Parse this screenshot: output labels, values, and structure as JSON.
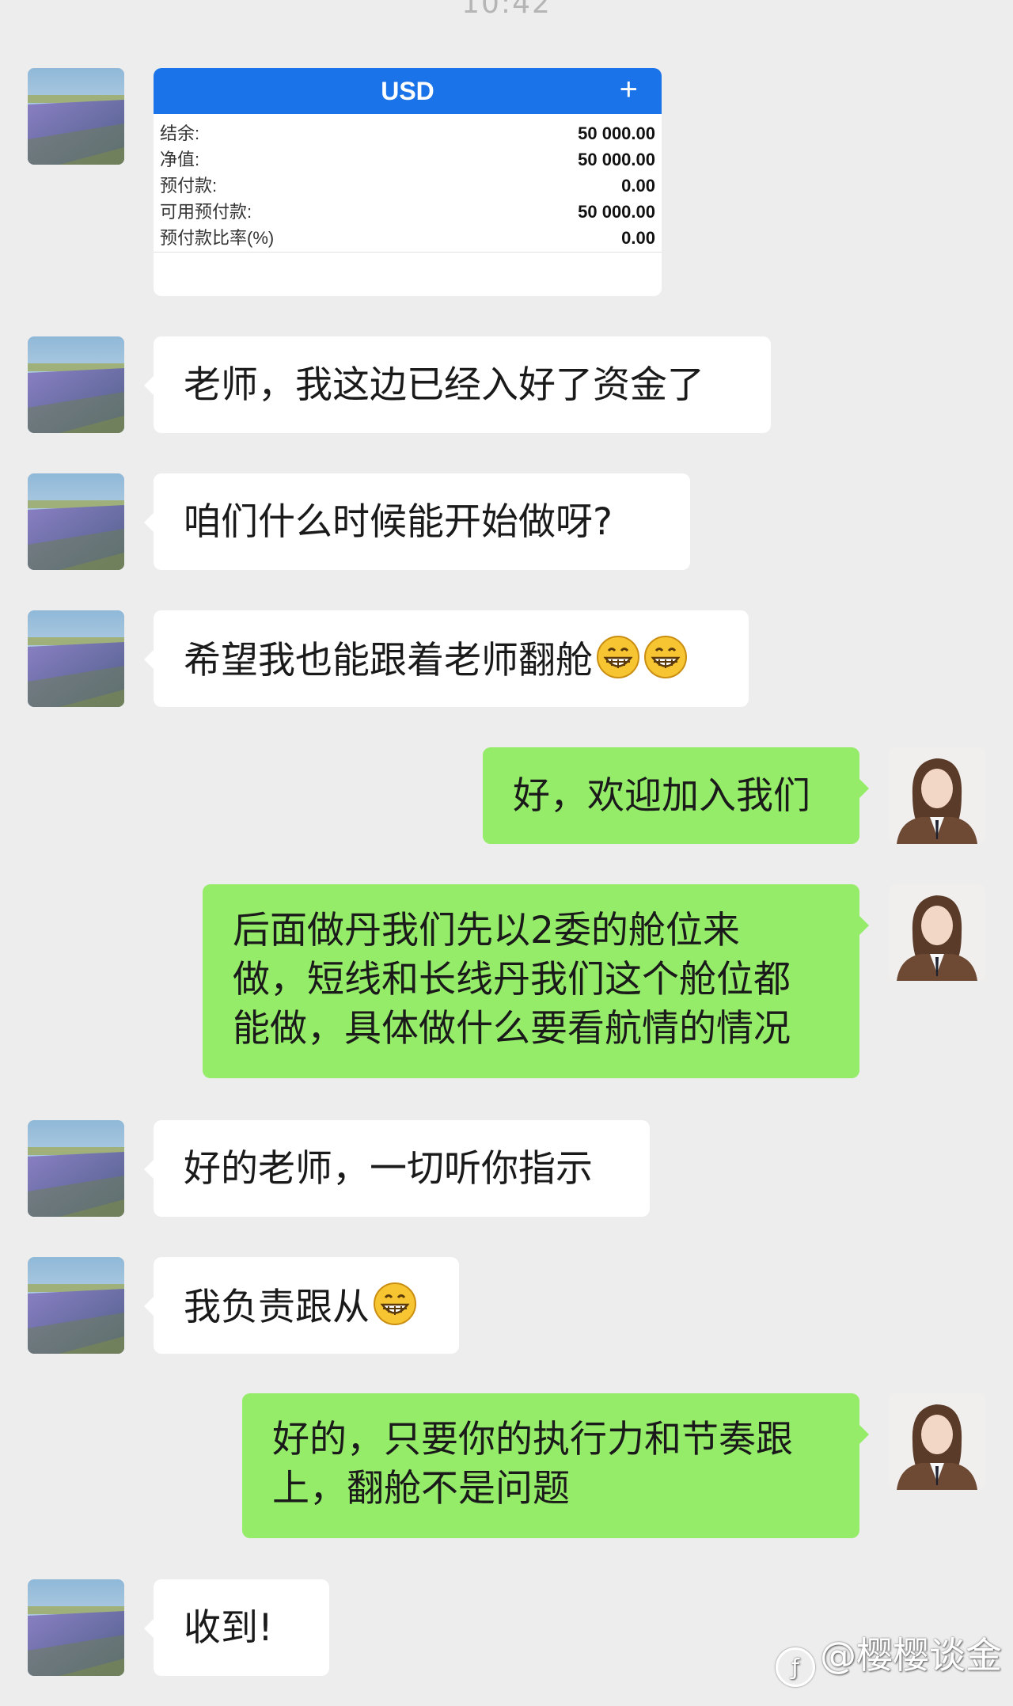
{
  "status_time": "10:42",
  "account_card": {
    "currency": "USD",
    "plus": "+",
    "rows": [
      {
        "label": "结余:",
        "value": "50 000.00"
      },
      {
        "label": "净值:",
        "value": "50 000.00"
      },
      {
        "label": "预付款:",
        "value": "0.00"
      },
      {
        "label": "可用预付款:",
        "value": "50 000.00"
      },
      {
        "label": "预付款比率(%)",
        "value": "0.00"
      }
    ]
  },
  "messages": [
    {
      "side": "in",
      "text": "老师，我这边已经入好了资金了"
    },
    {
      "side": "in",
      "text": "咱们什么时候能开始做呀?"
    },
    {
      "side": "in",
      "text": "希望我也能跟着老师翻舱",
      "emoji": [
        "grin-emoji",
        "grin-emoji"
      ]
    },
    {
      "side": "out",
      "text": "好，欢迎加入我们"
    },
    {
      "side": "out",
      "lines": [
        "后面做丹我们先以2委的舱位来",
        "做，短线和长线丹我们这个舱位都",
        "能做，具体做什么要看航情的情况"
      ]
    },
    {
      "side": "in",
      "text": "好的老师，一切听你指示"
    },
    {
      "side": "in",
      "text": "我负责跟从",
      "emoji": [
        "grin-emoji"
      ]
    },
    {
      "side": "out",
      "lines": [
        "好的，只要你的执行力和节奏跟",
        "上，翻舱不是问题"
      ]
    },
    {
      "side": "in",
      "text": "收到!"
    }
  ],
  "watermark": "@樱樱谈金",
  "colors": {
    "background": "#ededed",
    "incoming": "#ffffff",
    "outgoing": "#95ec69",
    "card_header": "#1a73e8"
  }
}
